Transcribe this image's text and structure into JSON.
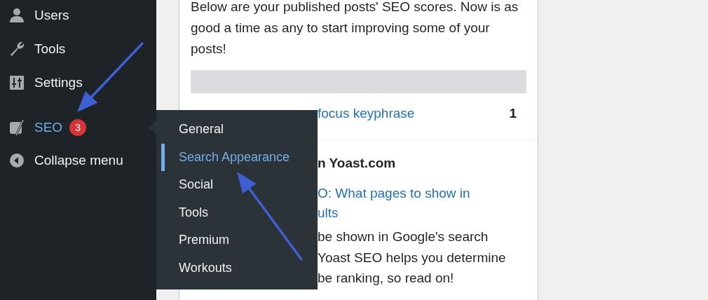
{
  "sidebar": {
    "items": [
      {
        "label": "Users",
        "kind": "user",
        "selected": false
      },
      {
        "label": "Tools",
        "kind": "wrench",
        "selected": false
      },
      {
        "label": "Settings",
        "kind": "sliders",
        "selected": false
      },
      {
        "label": "SEO",
        "kind": "logo",
        "selected": true,
        "badge": "3"
      },
      {
        "label": "Collapse menu",
        "kind": "collapse",
        "selected": false
      }
    ]
  },
  "flyout": {
    "items": [
      {
        "label": "General",
        "selected": false
      },
      {
        "label": "Search Appearance",
        "selected": true
      },
      {
        "label": "Social",
        "selected": false
      },
      {
        "label": "Tools",
        "selected": false
      },
      {
        "label": "Premium",
        "selected": false
      },
      {
        "label": "Workouts",
        "selected": false
      }
    ]
  },
  "card": {
    "intro": "Below are your published posts' SEO scores. Now is as good a time as any to start improving some of your posts!",
    "score_rows": [
      {
        "label": "focus keyphrase",
        "count": "1"
      }
    ],
    "news": {
      "heading": "n Yoast.com",
      "link_lines": [
        "O: What pages to show in",
        "ults"
      ],
      "text_lines": [
        "be shown in Google's search",
        "Yoast SEO helps you determine",
        "be ranking, so read on!"
      ]
    }
  }
}
